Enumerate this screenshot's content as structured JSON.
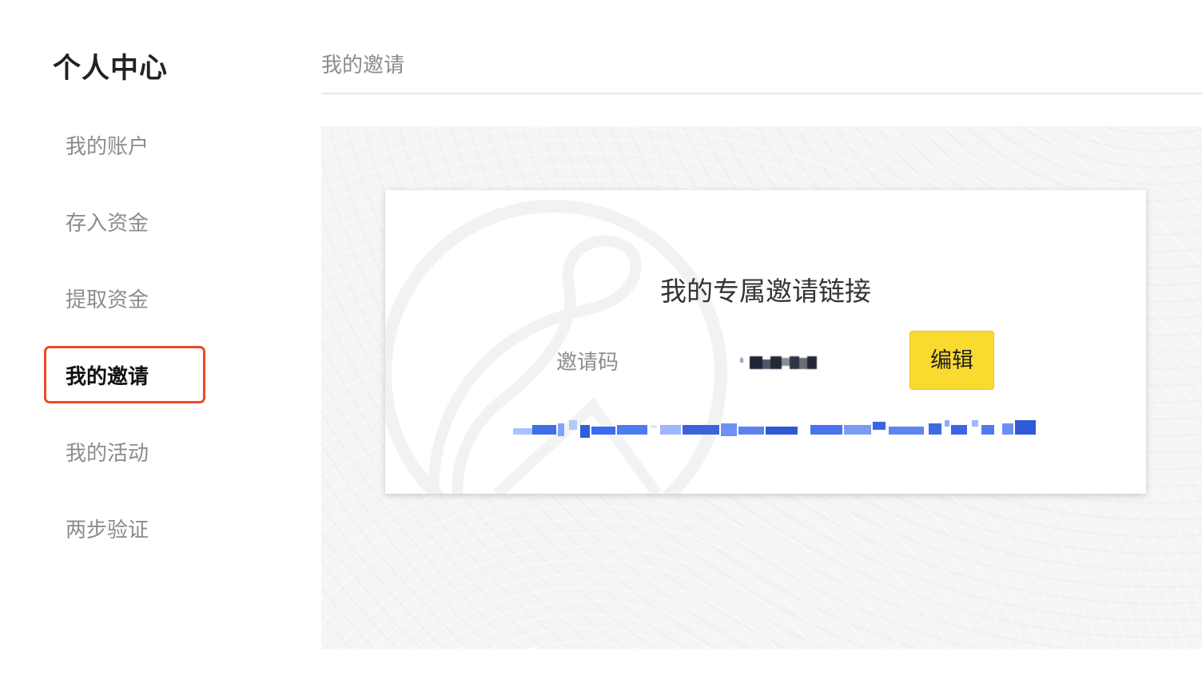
{
  "sidebar": {
    "title": "个人中心",
    "items": [
      {
        "label": "我的账户",
        "active": false
      },
      {
        "label": "存入资金",
        "active": false
      },
      {
        "label": "提取资金",
        "active": false
      },
      {
        "label": "我的邀请",
        "active": true
      },
      {
        "label": "我的活动",
        "active": false
      },
      {
        "label": "两步验证",
        "active": false
      }
    ]
  },
  "main": {
    "header_title": "我的邀请",
    "card": {
      "title": "我的专属邀请链接",
      "code_label": "邀请码",
      "edit_button_label": "编辑"
    }
  },
  "colors": {
    "accent_yellow": "#fbda2f",
    "highlight_red": "#ec4a26",
    "muted_text": "#8c8c8c",
    "link_blue": "#4a7cff"
  }
}
